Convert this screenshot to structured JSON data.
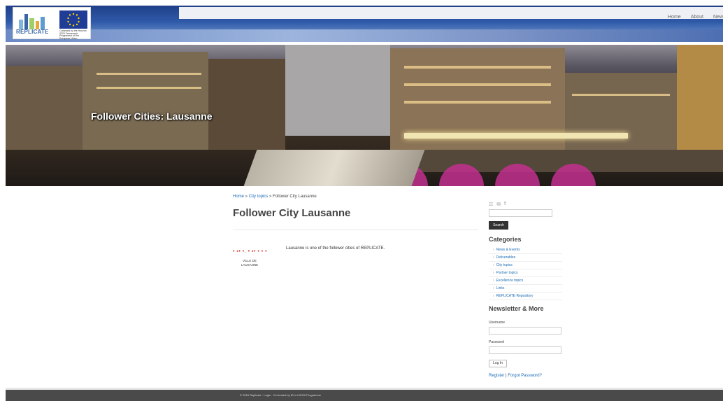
{
  "header": {
    "logo_text": "REPLICATE",
    "eu_caption": "Cofunded by the Horizon 2020 Framework Programme of the European Union",
    "nav": [
      "Home",
      "About",
      "New"
    ]
  },
  "hero": {
    "title": "Follower Cities: Lausanne"
  },
  "breadcrumb": {
    "home": "Home",
    "sep1": " » ",
    "city_topics": "City topics",
    "sep2": " » ",
    "current": "Follower City Lausanne"
  },
  "main": {
    "title": "Follower City Lausanne",
    "logo_dots": "• ▪• •. • ▪• • • •",
    "logo_line1": "VILLE DE",
    "logo_line2": "LAUSANNE",
    "text": "Lausanne is one of the follower cities of REPLICATE."
  },
  "sidebar": {
    "social": [
      "rss-icon",
      "mail-icon",
      "facebook-icon"
    ],
    "social_glyphs": [
      "☵",
      "✉",
      "f"
    ],
    "search_button": "Search",
    "categories_title": "Categories",
    "categories": [
      "News & Events",
      "Deliverables",
      "City topics",
      "Partner topics",
      "Excellence topics",
      "Links",
      "REPLICATE Repository"
    ],
    "newsletter_title": "Newsletter & More",
    "username_label": "Username",
    "password_label": "Password",
    "login_button": "Log In",
    "register": "Register",
    "separator": " | ",
    "forgot": "Forgot Password?"
  },
  "footer": {
    "text": "© 2016 Replicate · Login · Co-funded by EU's H2020 Programme"
  }
}
